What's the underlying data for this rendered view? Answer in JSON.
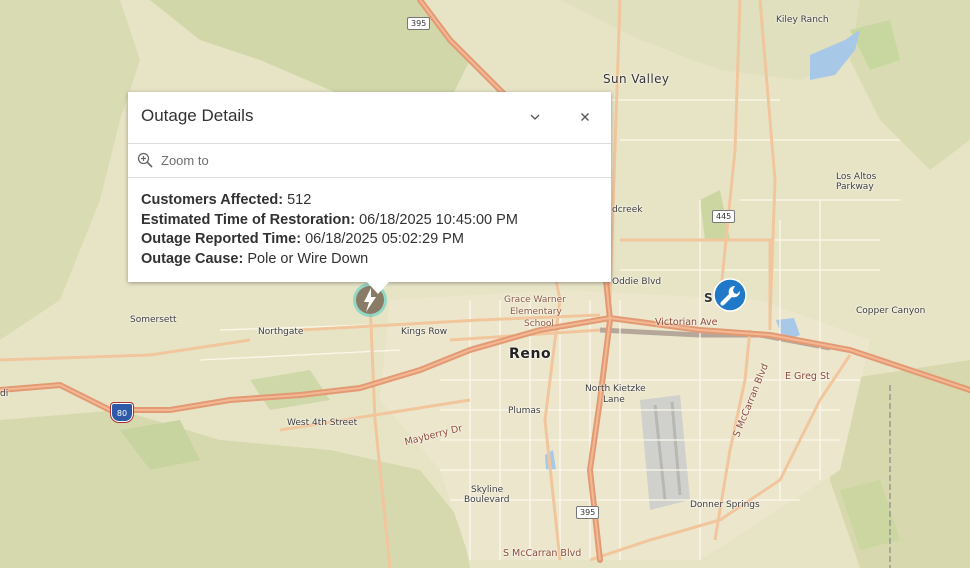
{
  "popup": {
    "title": "Outage Details",
    "zoom_label": "Zoom to",
    "fields": [
      {
        "label": "Customers Affected:",
        "value": "512"
      },
      {
        "label": "Estimated Time of Restoration:",
        "value": "06/18/2025 10:45:00 PM"
      },
      {
        "label": "Outage Reported Time:",
        "value": "06/18/2025 05:02:29 PM"
      },
      {
        "label": "Outage Cause:",
        "value": "Pole or Wire Down"
      }
    ]
  },
  "map": {
    "places": {
      "sun_valley": "Sun Valley",
      "kiley_ranch": "Kiley Ranch",
      "los_altos_1": "Los Altos",
      "los_altos_2": "Parkway",
      "wildcreek": "dcreek",
      "oddie": "Oddie Blvd",
      "sparks": "S     s",
      "copper_canyon": "Copper Canyon",
      "grace_1": "Grace Warner",
      "grace_2": "Elementary",
      "grace_3": "School",
      "reno": "Reno",
      "victorian": "Victorian Ave",
      "somersett": "Somersett",
      "northgate": "Northgate",
      "kings_row": "Kings Row",
      "north_kietzke_1": "North Kietzke",
      "north_kietzke_2": "Lane",
      "e_greg": "E Greg St",
      "plumas": "Plumas",
      "west4th": "West 4th Street",
      "mayberry": "Mayberry Dr",
      "s_mccarran_v": "S McCarran Blvd",
      "s_mccarran_h": "S McCarran Blvd",
      "skyline_1": "Skyline",
      "skyline_2": "Boulevard",
      "donner": "Donner Springs",
      "left_edge": "di"
    },
    "shields": {
      "us395_top": "395",
      "us395_bottom": "395",
      "nv445": "445",
      "i80": "80"
    },
    "icons": {
      "outage_marker": "lightning-bolt-icon",
      "crew_marker": "wrench-icon"
    },
    "colors": {
      "freeway": "#e39a74",
      "outage_marker": "#8a7b66",
      "outage_ring": "#4ecdc4",
      "crew_marker": "#1f78c8"
    }
  }
}
